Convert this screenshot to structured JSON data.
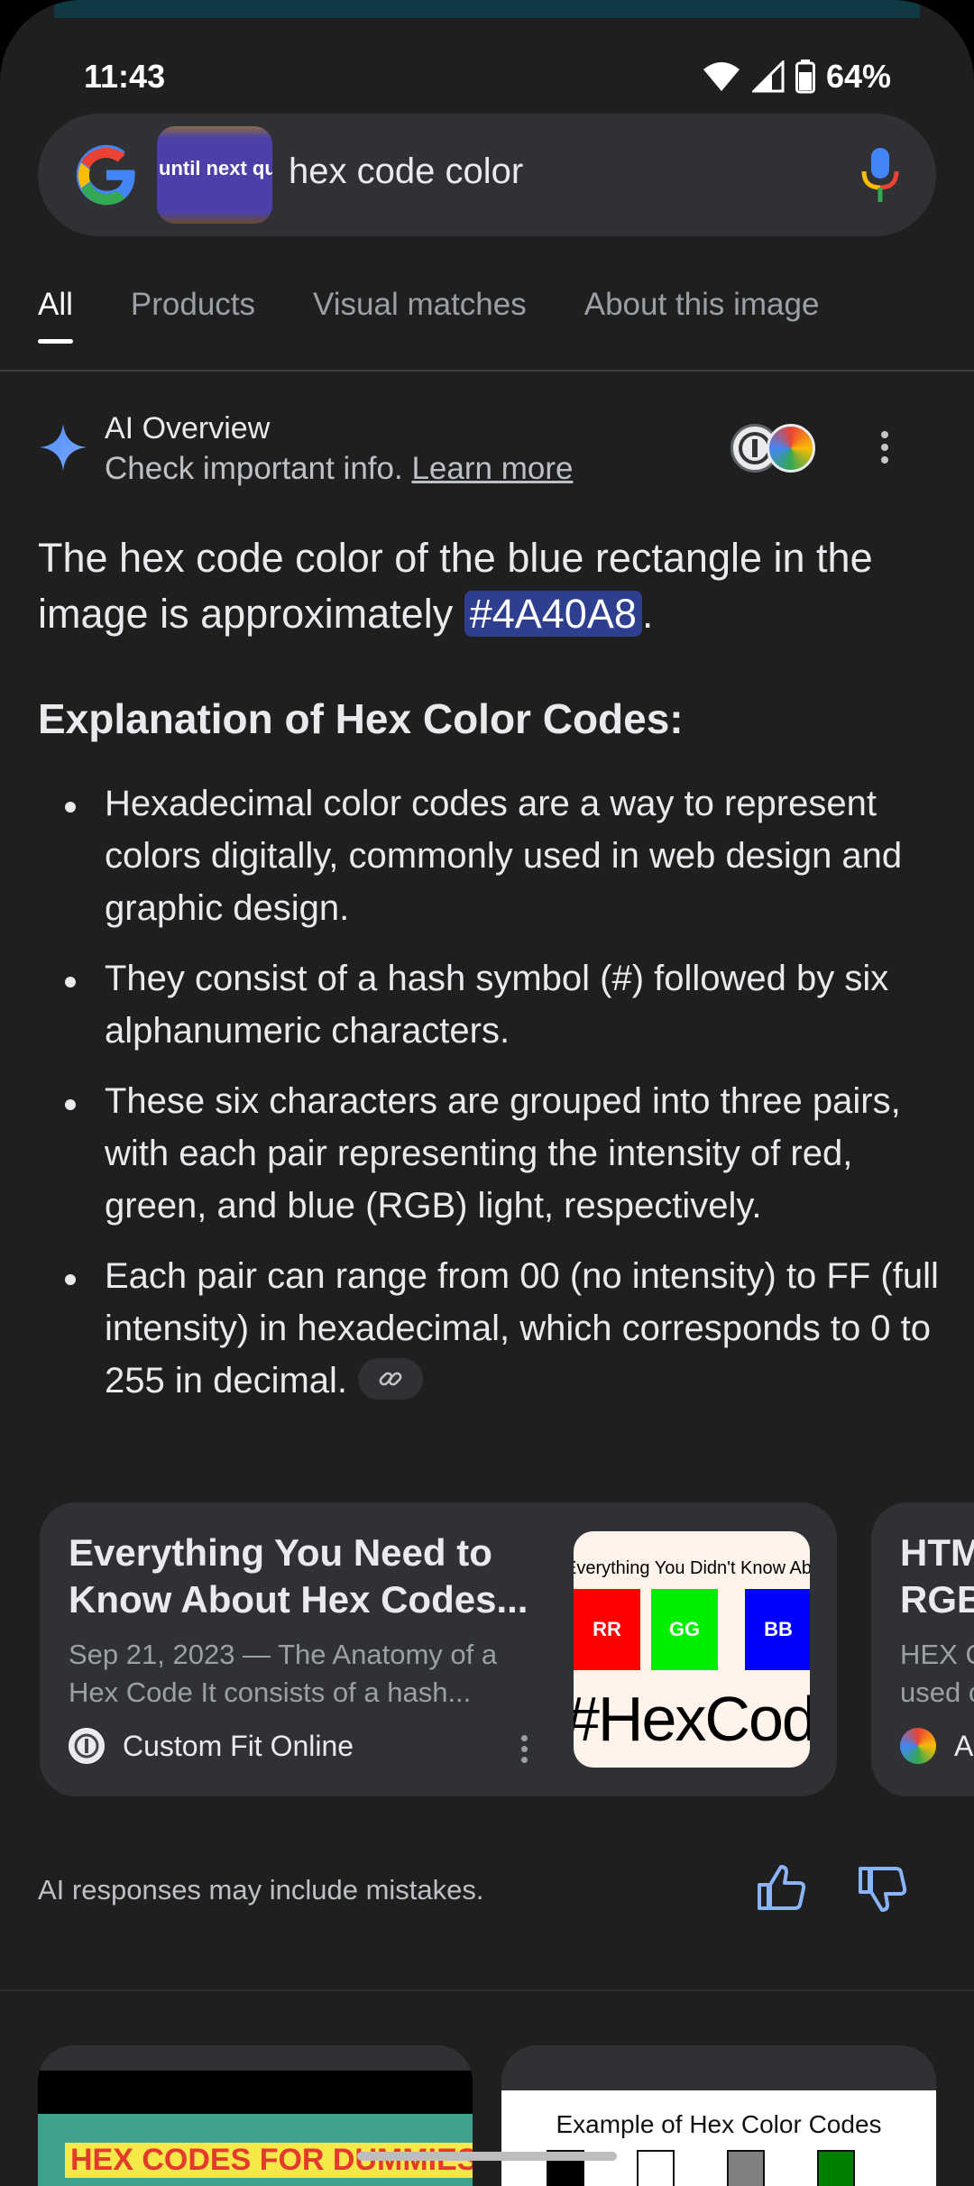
{
  "status": {
    "time": "11:43",
    "battery": "64%"
  },
  "search": {
    "thumbnail_text": "until next qu",
    "query": "hex code color"
  },
  "tabs": [
    {
      "label": "All",
      "active": true
    },
    {
      "label": "Products",
      "active": false
    },
    {
      "label": "Visual matches",
      "active": false
    },
    {
      "label": "About this image",
      "active": false
    }
  ],
  "ai_overview": {
    "title": "AI Overview",
    "subtitle": "Check important info.",
    "learn_more": "Learn more",
    "answer_prefix": "The hex code color of the blue rectangle in the image is approximately ",
    "answer_hex": "#4A40A8",
    "answer_suffix": ".",
    "section_heading": "Explanation of Hex Color Codes:",
    "bullets": [
      "Hexadecimal color codes are a way to represent colors digitally, commonly used in web design and graphic design.",
      "They consist of a hash symbol (#) followed by six alphanumeric characters.",
      "These six characters are grouped into three pairs, with each pair representing the intensity of red, green, and blue (RGB) light, respectively.",
      "Each pair can range from 00 (no intensity) to FF (full intensity) in hexadecimal, which corresponds to 0 to 255 in decimal."
    ]
  },
  "cards": [
    {
      "title": "Everything You Need to Know About Hex Codes...",
      "snippet": "Sep 21, 2023 — The Anatomy of a Hex Code It consists of a hash...",
      "source": "Custom Fit Online",
      "image": {
        "top_text": "Everything You Didn't Know About",
        "swatches": [
          "RR",
          "GG",
          "BB"
        ],
        "big_text": "#HexCodes"
      }
    },
    {
      "title": "HTML RGB",
      "snippet": "HEX C used c",
      "source": "As"
    }
  ],
  "disclaimer": "AI responses may include mistakes.",
  "bottom_cards": [
    {
      "label": "HEX CODES FOR DUMMIES"
    },
    {
      "caption": "Example of Hex Color Codes"
    }
  ],
  "colors": {
    "accent_hex_chip": "#2d3f8e",
    "blue_rectangle": "#4A40A8",
    "background": "#1f1f1f"
  }
}
